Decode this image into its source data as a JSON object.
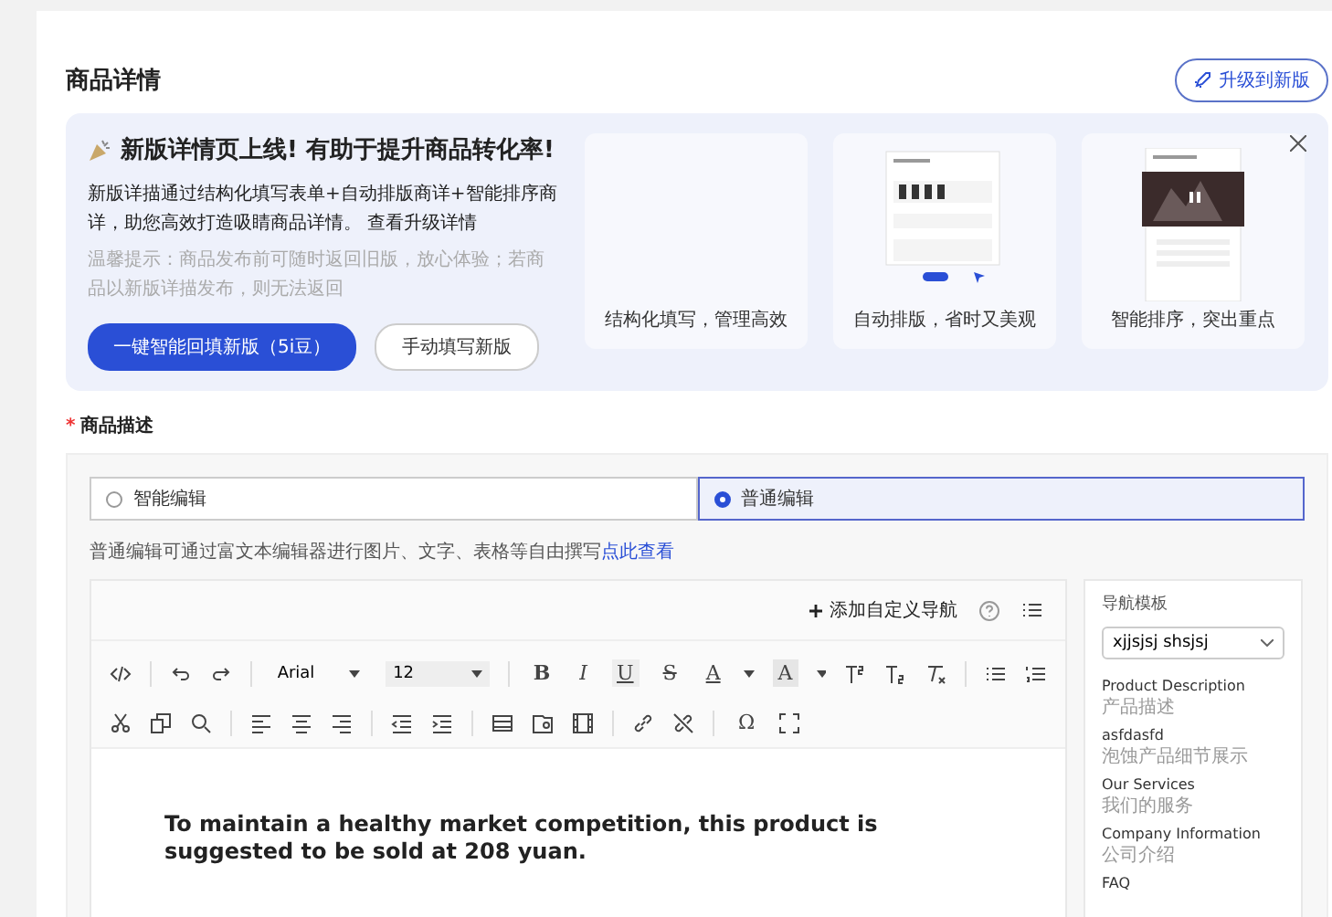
{
  "page_title": "商品详情",
  "upgrade_button": "升级到新版",
  "banner": {
    "heading": "新版详情页上线! 有助于提升商品转化率!",
    "body": "新版详描通过结构化填写表单+自动排版商详+智能排序商详，助您高效打造吸睛商品详情。 查看升级详情",
    "note": "温馨提示：商品发布前可随时返回旧版，放心体验；若商品以新版详描发布，则无法返回",
    "primary_button": "一键智能回填新版（5i豆）",
    "secondary_button": "手动填写新版",
    "cards": [
      {
        "kind": "blank",
        "caption": "结构化填写，管理高效"
      },
      {
        "kind": "layout",
        "caption": "自动排版，省时又美观"
      },
      {
        "kind": "video",
        "caption": "智能排序，突出重点"
      }
    ]
  },
  "description": {
    "label": "商品描述",
    "required_mark": "*",
    "modes": [
      {
        "label": "智能编辑",
        "selected": false
      },
      {
        "label": "普通编辑",
        "selected": true
      }
    ],
    "help": "普通编辑可通过富文本编辑器进行图片、文字、表格等自由撰写",
    "help_link": "点此查看"
  },
  "editor": {
    "add_nav": "添加自定义导航",
    "toolbar": {
      "font": "Arial",
      "size": "12",
      "glyph_buttons": [
        {
          "glyph": "B",
          "kind": "bold"
        },
        {
          "glyph": "I",
          "kind": "italic"
        },
        {
          "glyph": "U",
          "kind": "underline"
        },
        {
          "glyph": "S",
          "kind": "strike"
        },
        {
          "glyph": "A",
          "kind": "color"
        },
        {
          "glyph": "A",
          "kind": "highlight"
        }
      ],
      "symbol_button": "Ω"
    },
    "content": "To maintain a healthy market competition, this product is suggested to be sold at 208 yuan."
  },
  "nav_panel": {
    "title": "导航模板",
    "template": "xjjsjsj shsjsj",
    "items": [
      {
        "title": "Product Description",
        "subtitle": "产品描述"
      },
      {
        "title": "asfdasfd",
        "subtitle": "泡蚀产品细节展示"
      },
      {
        "title": "Our Services",
        "subtitle": "我们的服务"
      },
      {
        "title": "Company Information",
        "subtitle": "公司介绍"
      },
      {
        "title": "FAQ"
      }
    ]
  }
}
